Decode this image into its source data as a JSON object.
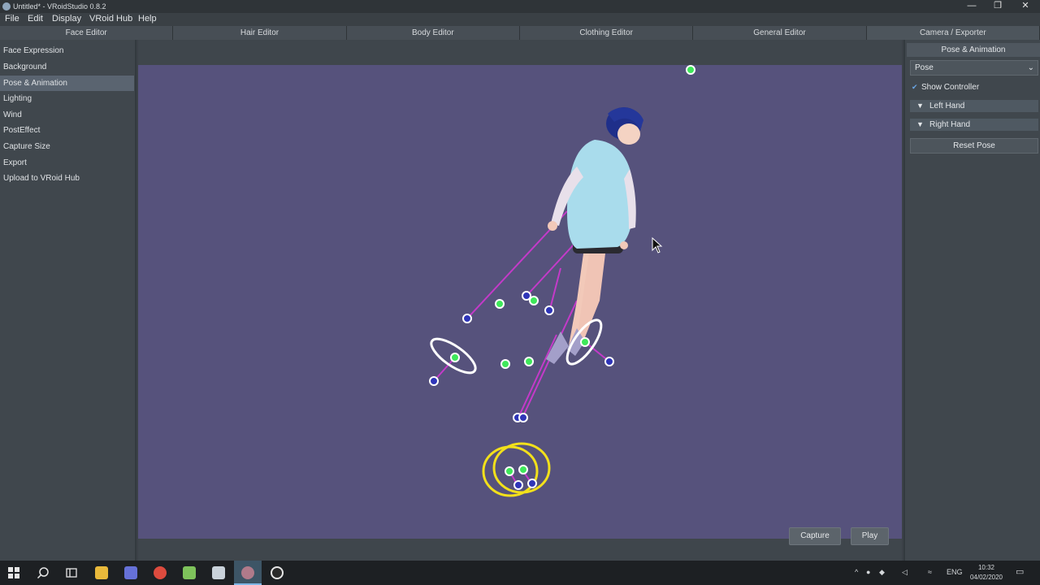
{
  "window": {
    "title": "Untitled* - VRoidStudio 0.8.2",
    "minimize": "—",
    "maximize": "❐",
    "close": "✕"
  },
  "menu": [
    "File",
    "Edit",
    "Display",
    "VRoid Hub",
    "Help"
  ],
  "editor_tabs": [
    "Face Editor",
    "Hair Editor",
    "Body Editor",
    "Clothing Editor",
    "General Editor",
    "Camera / Exporter"
  ],
  "sidebar": {
    "items": [
      "Face Expression",
      "Background",
      "Pose & Animation",
      "Lighting",
      "Wind",
      "PostEffect",
      "Capture Size",
      "Export",
      "Upload to VRoid Hub"
    ]
  },
  "viewport": {
    "capture_label": "Capture",
    "play_label": "Play"
  },
  "right_panel": {
    "header": "Pose & Animation",
    "mode_select": "Pose",
    "show_controller_label": "Show Controller",
    "show_controller_checked": true,
    "left_hand_label": "Left Hand",
    "right_hand_label": "Right Hand",
    "reset_pose_label": "Reset Pose"
  },
  "taskbar": {
    "language": "ENG",
    "time": "10:32",
    "date": "04/02/2020"
  },
  "colors": {
    "viewport_bg": "#56527c",
    "controller_line": "#c43ac9",
    "handle_green": "#3ee85a",
    "handle_blue": "#2f35b8",
    "ring_yellow": "#f2e01b"
  }
}
